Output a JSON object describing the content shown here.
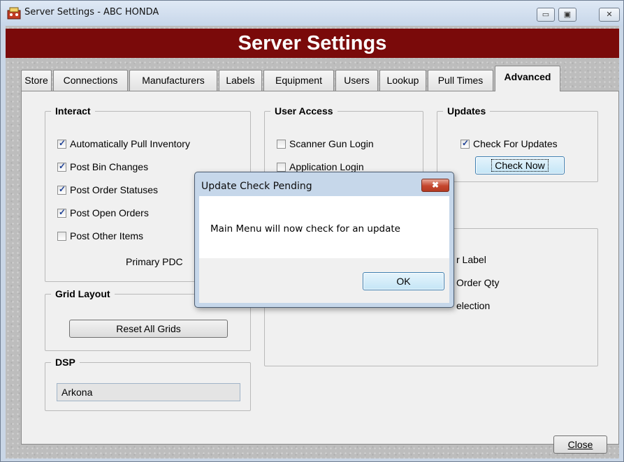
{
  "window": {
    "title": "Server Settings - ABC HONDA",
    "minimize_glyph": "▭",
    "maximize_glyph": "▣",
    "close_glyph": "✕",
    "icon": "application-icon"
  },
  "header": {
    "title": "Server Settings",
    "banner_color": "#7a0a0a"
  },
  "tabs": [
    {
      "label": "Store"
    },
    {
      "label": "Connections"
    },
    {
      "label": "Manufacturers"
    },
    {
      "label": "Labels"
    },
    {
      "label": "Equipment"
    },
    {
      "label": "Users"
    },
    {
      "label": "Lookup"
    },
    {
      "label": "Pull Times"
    },
    {
      "label": "Advanced",
      "active": true
    }
  ],
  "interact": {
    "legend": "Interact",
    "items": [
      {
        "label": "Automatically Pull Inventory",
        "checked": true
      },
      {
        "label": "Post Bin Changes",
        "checked": true
      },
      {
        "label": "Post Order Statuses",
        "checked": true
      },
      {
        "label": "Post Open Orders",
        "checked": true
      },
      {
        "label": "Post Other Items",
        "checked": false
      }
    ],
    "primary_pdc_label": "Primary PDC"
  },
  "user_access": {
    "legend": "User Access",
    "items": [
      {
        "label": "Scanner Gun Login",
        "checked": false
      },
      {
        "label": "Application Login",
        "checked": false
      }
    ]
  },
  "updates": {
    "legend": "Updates",
    "check_label": "Check For Updates",
    "checked": true,
    "check_now_label": "Check Now"
  },
  "partial_group": {
    "lines": [
      "r Label",
      "Order Qty",
      "election"
    ]
  },
  "grid_layout": {
    "legend": "Grid Layout",
    "reset_label": "Reset All Grids"
  },
  "dsp": {
    "legend": "DSP",
    "value": "Arkona"
  },
  "footer": {
    "close_label": "Close"
  },
  "dialog": {
    "title": "Update Check Pending",
    "close_glyph": "✖",
    "message": "Main Menu will now check for an update",
    "ok_label": "OK"
  }
}
